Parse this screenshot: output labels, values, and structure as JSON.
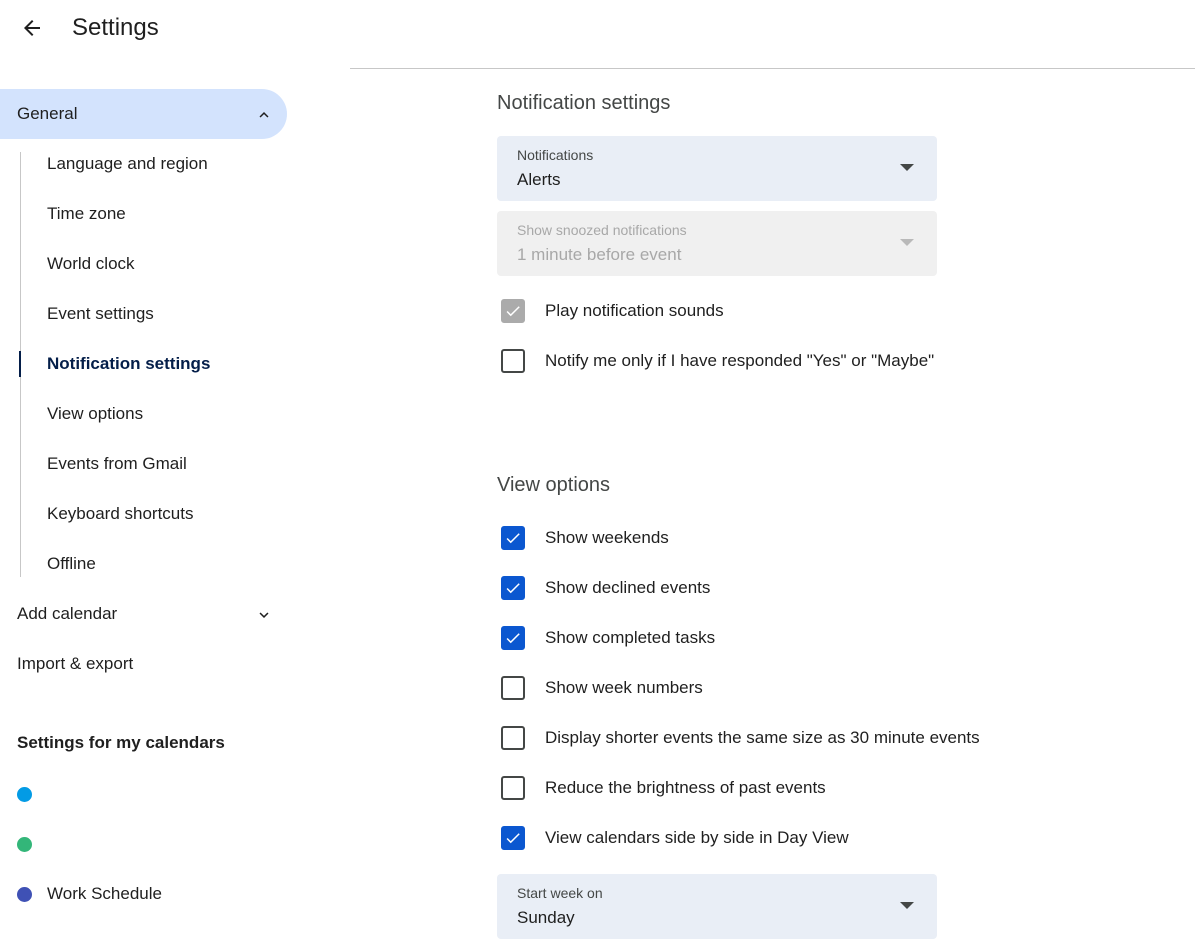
{
  "header": {
    "title": "Settings"
  },
  "sidebar": {
    "general_label": "General",
    "sub_items": [
      {
        "label": "Language and region"
      },
      {
        "label": "Time zone"
      },
      {
        "label": "World clock"
      },
      {
        "label": "Event settings"
      },
      {
        "label": "Notification settings",
        "active": true
      },
      {
        "label": "View options"
      },
      {
        "label": "Events from Gmail"
      },
      {
        "label": "Keyboard shortcuts"
      },
      {
        "label": "Offline"
      }
    ],
    "add_calendar": "Add calendar",
    "import_export": "Import & export",
    "my_calendars_title": "Settings for my calendars",
    "calendars": [
      {
        "label": "",
        "color": "#039be5"
      },
      {
        "label": "",
        "color": "#33b679"
      },
      {
        "label": "Work Schedule",
        "color": "#3f51b5"
      }
    ]
  },
  "notification_settings": {
    "title": "Notification settings",
    "notifications_select": {
      "label": "Notifications",
      "value": "Alerts"
    },
    "snoozed_select": {
      "label": "Show snoozed notifications",
      "value": "1 minute before event",
      "disabled": true
    },
    "checkboxes": [
      {
        "label": "Play notification sounds",
        "checked": true,
        "disabled": true
      },
      {
        "label": "Notify me only if I have responded \"Yes\" or \"Maybe\"",
        "checked": false
      }
    ]
  },
  "view_options": {
    "title": "View options",
    "checkboxes": [
      {
        "label": "Show weekends",
        "checked": true
      },
      {
        "label": "Show declined events",
        "checked": true
      },
      {
        "label": "Show completed tasks",
        "checked": true
      },
      {
        "label": "Show week numbers",
        "checked": false
      },
      {
        "label": "Display shorter events the same size as 30 minute events",
        "checked": false
      },
      {
        "label": "Reduce the brightness of past events",
        "checked": false
      },
      {
        "label": "View calendars side by side in Day View",
        "checked": true
      }
    ],
    "start_week_select": {
      "label": "Start week on",
      "value": "Sunday"
    }
  },
  "colors": {
    "accent": "#0b57d0",
    "active_nav_bg": "#d3e3fd",
    "select_bg": "#e9eef6"
  }
}
